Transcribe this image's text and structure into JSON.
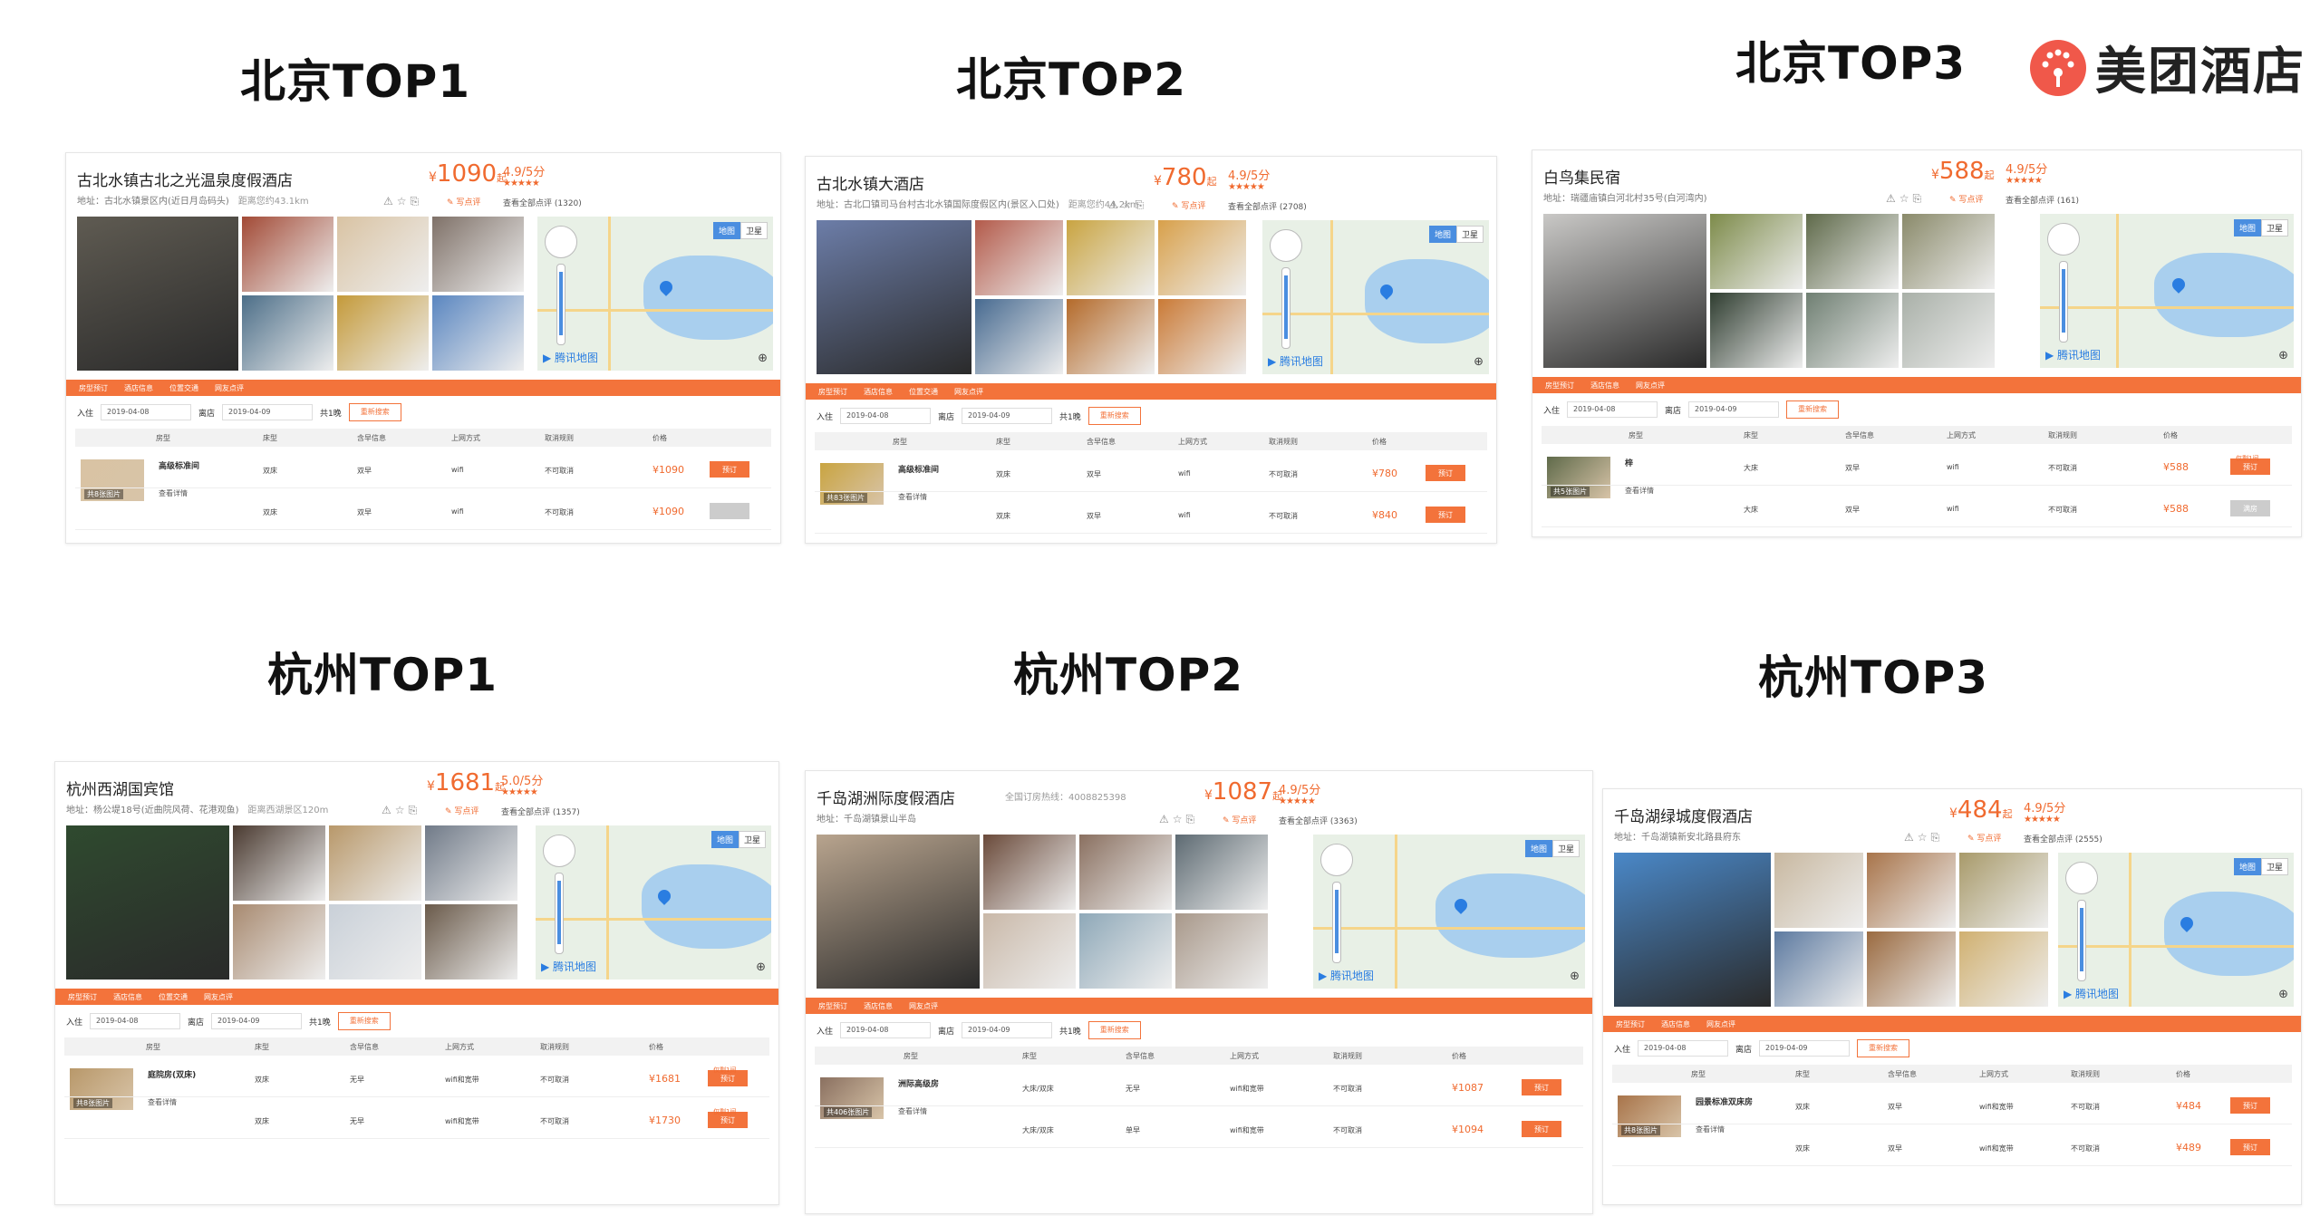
{
  "brand": {
    "name": "美团酒店",
    "icon": "meituan-logo-icon",
    "color": "#f0584a"
  },
  "accent": "#f3733b",
  "panels": [
    {
      "id": "bj1",
      "heading": "北京TOP1",
      "hotel_name": "古北水镇古北之光温泉度假酒店",
      "address": "地址：古北水镇景区内(近日月岛码头)",
      "distance": "距离您约43.1km",
      "price": "1090",
      "price_suffix": "起",
      "score": "4.9/5分",
      "reviews": "查看全部点评 (1320)",
      "write": "写点评",
      "tabs": [
        "房型预订",
        "酒店信息",
        "位置交通",
        "网友点评"
      ],
      "checkin_label": "入住",
      "checkin": "2019-04-08",
      "checkout_label": "离店",
      "checkout": "2019-04-09",
      "nights": "共1晚",
      "search": "重新搜索",
      "columns": [
        "房型",
        "床型",
        "含早信息",
        "上网方式",
        "取消规则",
        "价格"
      ],
      "room": {
        "name": "高级标准间",
        "thumb_label": "共8张图片",
        "detail": "查看详情"
      },
      "rows": [
        {
          "bed": "双床",
          "breakfast": "双早",
          "net": "wifi",
          "cancel": "不可取消",
          "price": "¥1090",
          "book": "预订",
          "disabled": false,
          "note": ""
        },
        {
          "bed": "双床",
          "breakfast": "双早",
          "net": "wifi",
          "cancel": "不可取消",
          "price": "¥1090",
          "book": "",
          "disabled": true,
          "note": ""
        }
      ],
      "map_logo": "腾讯地图",
      "map_btns": [
        "地图",
        "卫星"
      ]
    },
    {
      "id": "bj2",
      "heading": "北京TOP2",
      "hotel_name": "古北水镇大酒店",
      "address": "地址：古北口镇司马台村古北水镇国际度假区内(景区入口处)",
      "distance": "距离您约44.2km",
      "price": "780",
      "price_suffix": "起",
      "score": "4.9/5分",
      "reviews": "查看全部点评 (2708)",
      "write": "写点评",
      "tabs": [
        "房型预订",
        "酒店信息",
        "位置交通",
        "网友点评"
      ],
      "checkin_label": "入住",
      "checkin": "2019-04-08",
      "checkout_label": "离店",
      "checkout": "2019-04-09",
      "nights": "共1晚",
      "search": "重新搜索",
      "columns": [
        "房型",
        "床型",
        "含早信息",
        "上网方式",
        "取消规则",
        "价格"
      ],
      "room": {
        "name": "高级标准间",
        "thumb_label": "共83张图片",
        "detail": "查看详情"
      },
      "rows": [
        {
          "bed": "双床",
          "breakfast": "双早",
          "net": "wifi",
          "cancel": "不可取消",
          "price": "¥780",
          "book": "预订",
          "disabled": false,
          "note": ""
        },
        {
          "bed": "双床",
          "breakfast": "双早",
          "net": "wifi",
          "cancel": "不可取消",
          "price": "¥840",
          "book": "预订",
          "disabled": false,
          "note": ""
        }
      ],
      "map_logo": "腾讯地图",
      "map_btns": [
        "地图",
        "卫星"
      ]
    },
    {
      "id": "bj3",
      "heading": "北京TOP3",
      "hotel_name": "白鸟集民宿",
      "address": "地址：瑞疆庙镇白河北村35号(白河湾内)",
      "distance": "",
      "price": "588",
      "price_suffix": "起",
      "score": "4.9/5分",
      "reviews": "查看全部点评 (161)",
      "write": "写点评",
      "tabs": [
        "房型预订",
        "酒店信息",
        "网友点评"
      ],
      "checkin_label": "入住",
      "checkin": "2019-04-08",
      "checkout_label": "离店",
      "checkout": "2019-04-09",
      "nights": "",
      "search": "重新搜索",
      "columns": [
        "房型",
        "床型",
        "含早信息",
        "上网方式",
        "取消规则",
        "价格"
      ],
      "room": {
        "name": "梓",
        "thumb_label": "共5张图片",
        "detail": "查看详情"
      },
      "rows": [
        {
          "bed": "大床",
          "breakfast": "双早",
          "net": "wifi",
          "cancel": "不可取消",
          "price": "¥588",
          "book": "预订",
          "disabled": false,
          "note": "仅剩1间"
        },
        {
          "bed": "大床",
          "breakfast": "双早",
          "net": "wifi",
          "cancel": "不可取消",
          "price": "¥588",
          "book": "满房",
          "disabled": true,
          "note": ""
        }
      ],
      "map_logo": "腾讯地图",
      "map_btns": [
        "地图",
        "卫星"
      ]
    },
    {
      "id": "hz1",
      "heading": "杭州TOP1",
      "hotel_name": "杭州西湖国宾馆",
      "address": "地址：杨公堤18号(近曲院风荷、花港观鱼)",
      "distance": "距离西湖景区120m",
      "price": "1681",
      "price_suffix": "起",
      "score": "5.0/5分",
      "reviews": "查看全部点评 (1357)",
      "write": "写点评",
      "tabs": [
        "房型预订",
        "酒店信息",
        "位置交通",
        "网友点评"
      ],
      "checkin_label": "入住",
      "checkin": "2019-04-08",
      "checkout_label": "离店",
      "checkout": "2019-04-09",
      "nights": "共1晚",
      "search": "重新搜索",
      "columns": [
        "房型",
        "床型",
        "含早信息",
        "上网方式",
        "取消规则",
        "价格"
      ],
      "room": {
        "name": "庭院房(双床)",
        "thumb_label": "共8张图片",
        "detail": "查看详情"
      },
      "rows": [
        {
          "bed": "双床",
          "breakfast": "无早",
          "net": "wifi和宽带",
          "cancel": "不可取消",
          "price": "¥1681",
          "book": "预订",
          "disabled": false,
          "note": "仅剩1间"
        },
        {
          "bed": "双床",
          "breakfast": "无早",
          "net": "wifi和宽带",
          "cancel": "不可取消",
          "price": "¥1730",
          "book": "预订",
          "disabled": false,
          "note": "仅剩1间"
        }
      ],
      "map_logo": "腾讯地图",
      "map_btns": [
        "地图",
        "卫星"
      ]
    },
    {
      "id": "hz2",
      "heading": "杭州TOP2",
      "hotel_name": "千岛湖洲际度假酒店",
      "phone": "全国订房热线：4008825398",
      "address": "地址：千岛湖镇景山半岛",
      "distance": "",
      "price": "1087",
      "price_suffix": "起",
      "score": "4.9/5分",
      "reviews": "查看全部点评 (3363)",
      "write": "写点评",
      "tabs": [
        "房型预订",
        "酒店信息",
        "网友点评"
      ],
      "checkin_label": "入住",
      "checkin": "2019-04-08",
      "checkout_label": "离店",
      "checkout": "2019-04-09",
      "nights": "共1晚",
      "search": "重新搜索",
      "columns": [
        "房型",
        "床型",
        "含早信息",
        "上网方式",
        "取消规则",
        "价格"
      ],
      "room": {
        "name": "洲际高级房",
        "thumb_label": "共406张图片",
        "detail": "查看详情"
      },
      "rows": [
        {
          "bed": "大床/双床",
          "breakfast": "无早",
          "net": "wifi和宽带",
          "cancel": "不可取消",
          "price": "¥1087",
          "book": "预订",
          "disabled": false,
          "note": ""
        },
        {
          "bed": "大床/双床",
          "breakfast": "单早",
          "net": "wifi和宽带",
          "cancel": "不可取消",
          "price": "¥1094",
          "book": "预订",
          "disabled": false,
          "note": ""
        }
      ],
      "map_logo": "腾讯地图",
      "map_btns": [
        "地图",
        "卫星"
      ]
    },
    {
      "id": "hz3",
      "heading": "杭州TOP3",
      "hotel_name": "千岛湖绿城度假酒店",
      "address": "地址：千岛湖镇新安北路县府东",
      "distance": "",
      "price": "484",
      "price_suffix": "起",
      "score": "4.9/5分",
      "reviews": "查看全部点评 (2555)",
      "write": "写点评",
      "tabs": [
        "房型预订",
        "酒店信息",
        "网友点评"
      ],
      "checkin_label": "入住",
      "checkin": "2019-04-08",
      "checkout_label": "离店",
      "checkout": "2019-04-09",
      "nights": "",
      "search": "重新搜索",
      "columns": [
        "房型",
        "床型",
        "含早信息",
        "上网方式",
        "取消规则",
        "价格"
      ],
      "room": {
        "name": "园景标准双床房",
        "thumb_label": "共8张图片",
        "detail": "查看详情"
      },
      "rows": [
        {
          "bed": "双床",
          "breakfast": "双早",
          "net": "wifi和宽带",
          "cancel": "不可取消",
          "price": "¥484",
          "book": "预订",
          "disabled": false,
          "note": ""
        },
        {
          "bed": "双床",
          "breakfast": "双早",
          "net": "wifi和宽带",
          "cancel": "不可取消",
          "price": "¥489",
          "book": "预订",
          "disabled": false,
          "note": ""
        }
      ],
      "map_logo": "腾讯地图",
      "map_btns": [
        "地图",
        "卫星"
      ]
    }
  ]
}
